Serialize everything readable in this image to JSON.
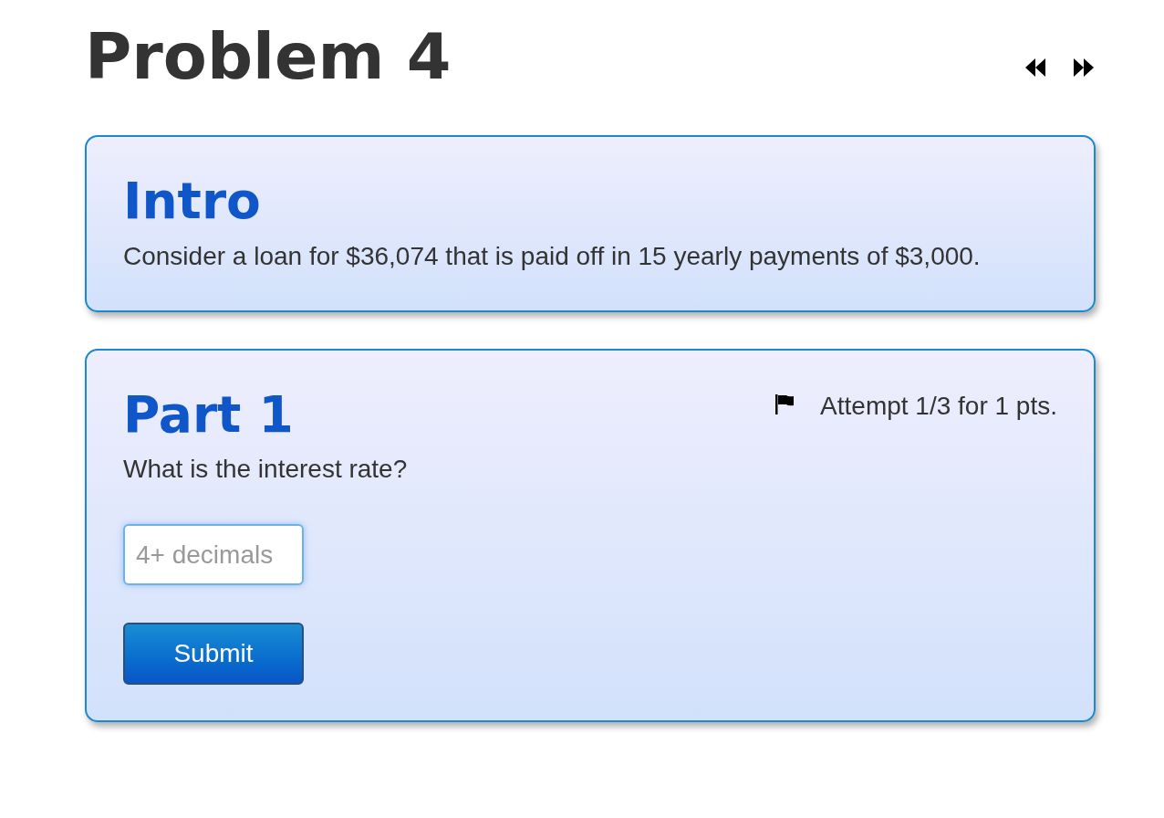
{
  "page": {
    "title": "Problem 4"
  },
  "intro": {
    "title": "Intro",
    "text": "Consider a loan for $36,074 that is paid off in 15 yearly payments of $3,000."
  },
  "part": {
    "title": "Part 1",
    "attempt": "Attempt 1/3 for 1 pts.",
    "question": "What is the interest rate?",
    "answer": {
      "placeholder": "4+ decimals"
    },
    "submit": "Submit"
  }
}
